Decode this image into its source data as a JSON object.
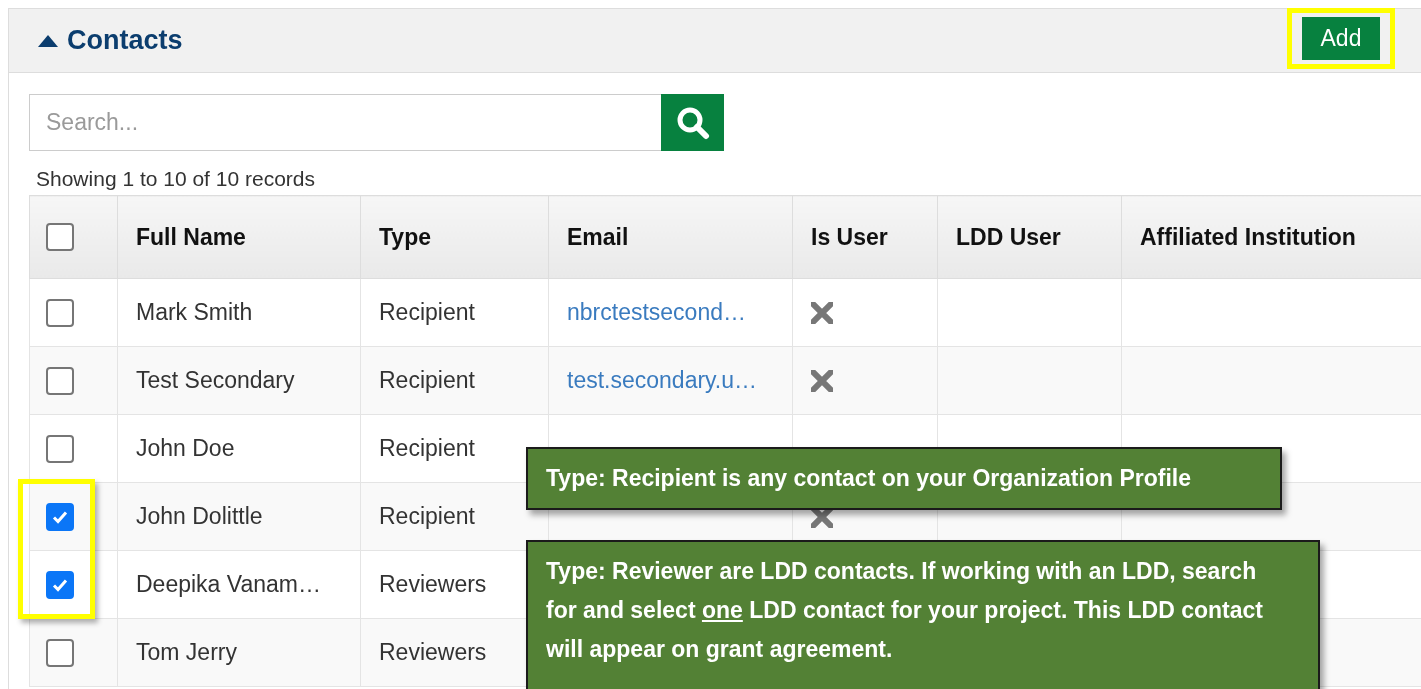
{
  "panel": {
    "title": "Contacts",
    "expanded": true,
    "add_button": {
      "label": "Add",
      "highlighted": true
    }
  },
  "search": {
    "placeholder": "Search..."
  },
  "records_info": "Showing 1 to 10 of 10 records",
  "table": {
    "select_all": {
      "checked": false
    },
    "columns": [
      "Full Name",
      "Type",
      "Email",
      "Is User",
      "LDD User",
      "Affiliated Institution"
    ],
    "rows": [
      {
        "checked": false,
        "highlighted": false,
        "full_name": "Mark Smith",
        "type": "Recipient",
        "email": "nbrctestsecond…",
        "is_user": false
      },
      {
        "checked": false,
        "highlighted": false,
        "full_name": "Test Secondary",
        "type": "Recipient",
        "email": "test.secondary.u…",
        "is_user": false
      },
      {
        "checked": false,
        "highlighted": false,
        "full_name": "John Doe",
        "type": "Recipient"
      },
      {
        "checked": true,
        "highlighted": true,
        "full_name": "John Dolittle",
        "type": "Recipient",
        "is_user": false
      },
      {
        "checked": true,
        "highlighted": true,
        "full_name": "Deepika Vanam…",
        "type": "Reviewers"
      },
      {
        "checked": false,
        "highlighted": false,
        "full_name": "Tom Jerry",
        "type": "Reviewers"
      }
    ]
  },
  "callouts": [
    {
      "before": "Type: Recipient is any contact on your Organization Profile"
    },
    {
      "before": "Type: Reviewer are LDD contacts. If working with an LDD, search for and select ",
      "underlined": "one",
      "after": " LDD contact for your project. This LDD contact will appear on grant agreement."
    }
  ]
}
